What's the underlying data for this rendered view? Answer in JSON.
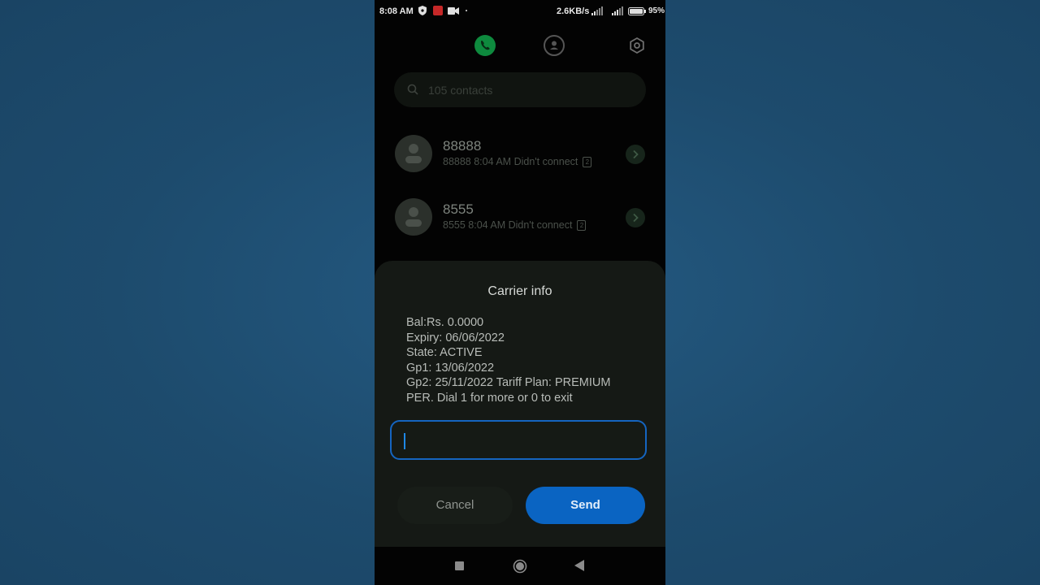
{
  "status_bar": {
    "time": "8:08 AM",
    "network_speed": "2.6KB/s",
    "battery_percent": "95%"
  },
  "tabs": [
    {
      "icon": "phone-icon",
      "active": true
    },
    {
      "icon": "contacts-icon",
      "active": false
    },
    {
      "icon": "settings-icon",
      "active": false
    }
  ],
  "search": {
    "placeholder": "105 contacts"
  },
  "call_log": [
    {
      "name": "88888",
      "detail": "88888  8:04 AM Didn't connect",
      "sim": "2"
    },
    {
      "name": "8555",
      "detail": "8555  8:04 AM Didn't connect",
      "sim": "2"
    }
  ],
  "dialog": {
    "title": "Carrier info",
    "message_lines": [
      "Bal:Rs. 0.0000",
      "Expiry: 06/06/2022",
      "State: ACTIVE",
      "Gp1: 13/06/2022",
      "Gp2: 25/11/2022 Tariff Plan: PREMIUM",
      "PER. Dial 1 for more or 0 to exit"
    ],
    "input_value": "",
    "cancel_label": "Cancel",
    "send_label": "Send"
  },
  "colors": {
    "accent_green": "#0e8a3e",
    "accent_blue": "#0a64c2",
    "background": "#1e4b6e"
  }
}
